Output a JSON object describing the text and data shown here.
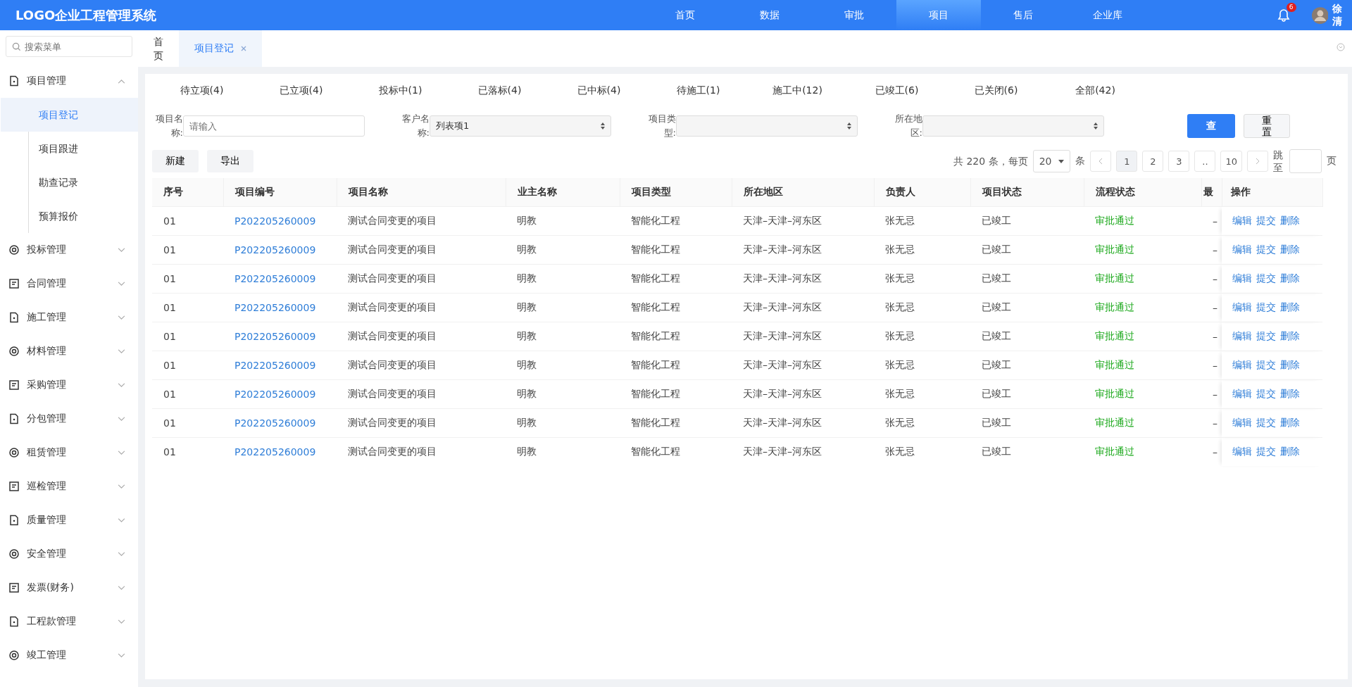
{
  "header": {
    "logo": "LOGO企业工程管理系统",
    "nav": [
      {
        "label": "首页",
        "selected": false
      },
      {
        "label": "数据",
        "selected": false
      },
      {
        "label": "审批",
        "selected": false
      },
      {
        "label": "项目",
        "selected": true
      },
      {
        "label": "售后",
        "selected": false
      },
      {
        "label": "企业库",
        "selected": false
      }
    ],
    "notification_count": "6",
    "user_name": "徐清"
  },
  "sidebar": {
    "search_placeholder": "搜索菜单",
    "items": [
      {
        "label": "项目管理",
        "expanded": true,
        "children": [
          {
            "label": "项目登记",
            "selected": true
          },
          {
            "label": "项目跟进",
            "selected": false
          },
          {
            "label": "勘查记录",
            "selected": false
          },
          {
            "label": "预算报价",
            "selected": false
          }
        ]
      },
      {
        "label": "投标管理",
        "expanded": false
      },
      {
        "label": "合同管理",
        "expanded": false
      },
      {
        "label": "施工管理",
        "expanded": false
      },
      {
        "label": "材料管理",
        "expanded": false
      },
      {
        "label": "采购管理",
        "expanded": false
      },
      {
        "label": "分包管理",
        "expanded": false
      },
      {
        "label": "租赁管理",
        "expanded": false
      },
      {
        "label": "巡检管理",
        "expanded": false
      },
      {
        "label": "质量管理",
        "expanded": false
      },
      {
        "label": "安全管理",
        "expanded": false
      },
      {
        "label": "发票(财务)",
        "expanded": false
      },
      {
        "label": "工程款管理",
        "expanded": false
      },
      {
        "label": "竣工管理",
        "expanded": false
      }
    ]
  },
  "page_tabs": [
    {
      "label": "首页",
      "selected": false,
      "closable": false
    },
    {
      "label": "项目登记",
      "selected": true,
      "closable": true
    }
  ],
  "status_tabs": [
    {
      "label": "待立项(4)"
    },
    {
      "label": "已立项(4)"
    },
    {
      "label": "投标中(1)"
    },
    {
      "label": "已落标(4)"
    },
    {
      "label": "已中标(4)"
    },
    {
      "label": "待施工(1)"
    },
    {
      "label": "施工中(12)"
    },
    {
      "label": "已竣工(6)"
    },
    {
      "label": "已关闭(6)"
    },
    {
      "label": "全部(42)"
    }
  ],
  "filters": [
    {
      "kind": "input",
      "label": "项目名称:",
      "placeholder": "请输入"
    },
    {
      "kind": "select",
      "label": "客户名称:",
      "value": "列表项1"
    },
    {
      "kind": "select",
      "label": "项目类型:"
    },
    {
      "kind": "select",
      "label": "所在地区:"
    }
  ],
  "query_button": "查",
  "reset_button": "重置",
  "actions": [
    "新建",
    "导出"
  ],
  "pagination": {
    "total": "共 220 条，每页",
    "page_size": "20",
    "unit": "条",
    "pages": [
      {
        "label": "1",
        "selected": true
      },
      {
        "label": "2",
        "selected": false
      },
      {
        "label": "3",
        "selected": false
      },
      {
        "label": "..",
        "selected": false
      },
      {
        "label": "10",
        "selected": false
      }
    ],
    "jump_label": "跳至",
    "page_word": "页"
  },
  "table": {
    "columns": [
      "序号",
      "项目编号",
      "项目名称",
      "业主名称",
      "项目类型",
      "所在地区",
      "负责人",
      "项目状态",
      "流程状态",
      "最",
      "操作"
    ],
    "rows": [
      {
        "cells": [
          "01",
          "P202205260009",
          "测试合同变更的项目",
          "明教",
          "智能化工程",
          "天津–天津–河东区",
          "张无忌",
          "已竣工",
          "审批通过",
          "–"
        ],
        "actions": [
          "编辑",
          "提交",
          "删除"
        ]
      },
      {
        "cells": [
          "01",
          "P202205260009",
          "测试合同变更的项目",
          "明教",
          "智能化工程",
          "天津–天津–河东区",
          "张无忌",
          "已竣工",
          "审批通过",
          "–"
        ],
        "actions": [
          "编辑",
          "提交",
          "删除"
        ]
      },
      {
        "cells": [
          "01",
          "P202205260009",
          "测试合同变更的项目",
          "明教",
          "智能化工程",
          "天津–天津–河东区",
          "张无忌",
          "已竣工",
          "审批通过",
          "–"
        ],
        "actions": [
          "编辑",
          "提交",
          "删除"
        ]
      },
      {
        "cells": [
          "01",
          "P202205260009",
          "测试合同变更的项目",
          "明教",
          "智能化工程",
          "天津–天津–河东区",
          "张无忌",
          "已竣工",
          "审批通过",
          "–"
        ],
        "actions": [
          "编辑",
          "提交",
          "删除"
        ]
      },
      {
        "cells": [
          "01",
          "P202205260009",
          "测试合同变更的项目",
          "明教",
          "智能化工程",
          "天津–天津–河东区",
          "张无忌",
          "已竣工",
          "审批通过",
          "–"
        ],
        "actions": [
          "编辑",
          "提交",
          "删除"
        ]
      },
      {
        "cells": [
          "01",
          "P202205260009",
          "测试合同变更的项目",
          "明教",
          "智能化工程",
          "天津–天津–河东区",
          "张无忌",
          "已竣工",
          "审批通过",
          "–"
        ],
        "actions": [
          "编辑",
          "提交",
          "删除"
        ]
      },
      {
        "cells": [
          "01",
          "P202205260009",
          "测试合同变更的项目",
          "明教",
          "智能化工程",
          "天津–天津–河东区",
          "张无忌",
          "已竣工",
          "审批通过",
          "–"
        ],
        "actions": [
          "编辑",
          "提交",
          "删除"
        ]
      },
      {
        "cells": [
          "01",
          "P202205260009",
          "测试合同变更的项目",
          "明教",
          "智能化工程",
          "天津–天津–河东区",
          "张无忌",
          "已竣工",
          "审批通过",
          "–"
        ],
        "actions": [
          "编辑",
          "提交",
          "删除"
        ]
      },
      {
        "cells": [
          "01",
          "P202205260009",
          "测试合同变更的项目",
          "明教",
          "智能化工程",
          "天津–天津–河东区",
          "张无忌",
          "已竣工",
          "审批通过",
          "–"
        ],
        "actions": [
          "编辑",
          "提交",
          "删除"
        ]
      }
    ]
  }
}
